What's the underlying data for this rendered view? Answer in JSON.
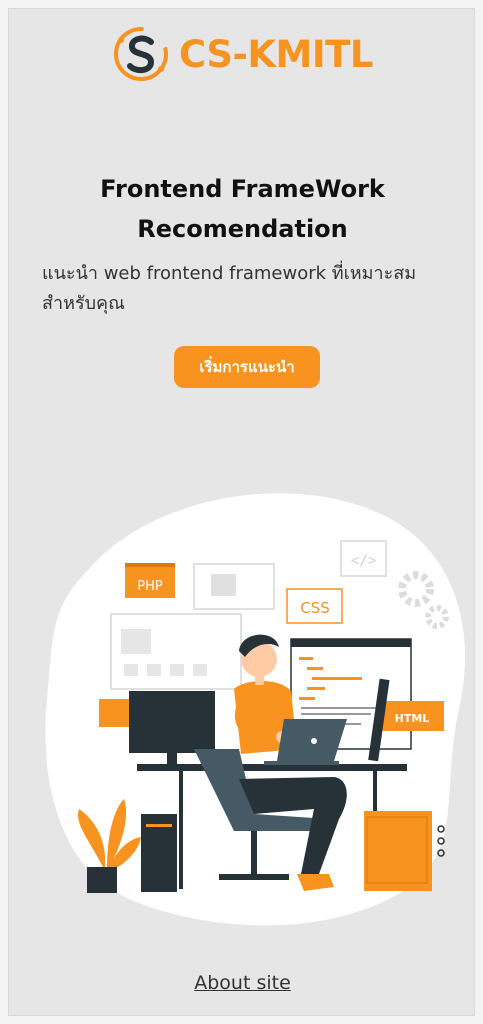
{
  "header": {
    "logo_text": "CS-KMITL"
  },
  "hero": {
    "title_line1": "Frontend FrameWork",
    "title_line2": "Recomendation",
    "subtitle_line1": "แนะนำ web frontend framework ที่เหมาะสม",
    "subtitle_line2": "สำหรับคุณ",
    "cta_label": "เริ่มการแนะนำ"
  },
  "illustration": {
    "badge_php": "PHP",
    "badge_css": "CSS",
    "badge_html": "HTML"
  },
  "footer": {
    "about_link": "About site"
  },
  "colors": {
    "accent": "#f7931e",
    "background": "#e6e6e6",
    "dark": "#263238"
  }
}
